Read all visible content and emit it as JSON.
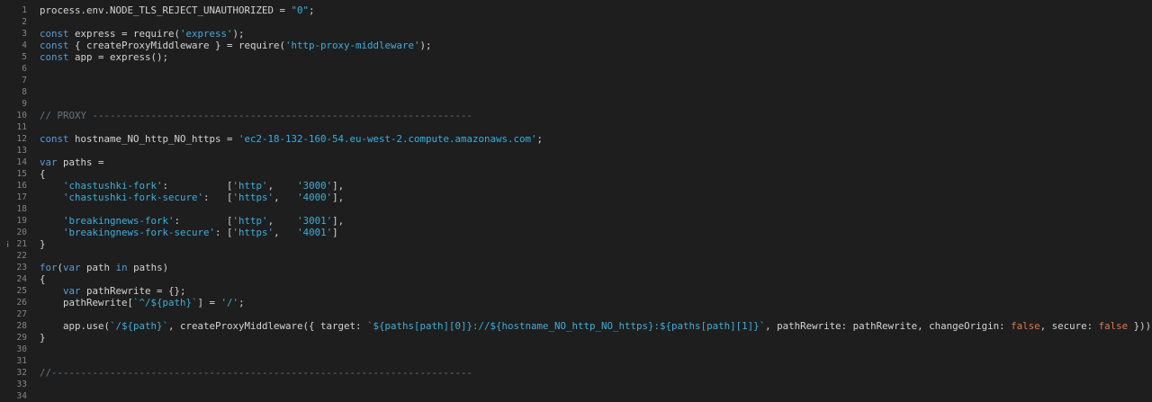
{
  "editor": {
    "gutter_glyph": "¡",
    "lines": [
      {
        "n": "1",
        "t": [
          [
            "plain",
            "process.env.NODE_TLS_REJECT_UNAUTHORIZED = "
          ],
          [
            "str",
            "\"0\""
          ],
          [
            "plain",
            ";"
          ]
        ]
      },
      {
        "n": "2",
        "t": []
      },
      {
        "n": "3",
        "t": [
          [
            "kw",
            "const"
          ],
          [
            "plain",
            " express = require("
          ],
          [
            "str",
            "'express'"
          ],
          [
            "plain",
            ");"
          ]
        ]
      },
      {
        "n": "4",
        "t": [
          [
            "kw",
            "const"
          ],
          [
            "plain",
            " { createProxyMiddleware } = require("
          ],
          [
            "str",
            "'http-proxy-middleware'"
          ],
          [
            "plain",
            ");"
          ]
        ]
      },
      {
        "n": "5",
        "t": [
          [
            "kw",
            "const"
          ],
          [
            "plain",
            " app = express();"
          ]
        ]
      },
      {
        "n": "6",
        "t": []
      },
      {
        "n": "7",
        "t": []
      },
      {
        "n": "8",
        "t": []
      },
      {
        "n": "9",
        "t": []
      },
      {
        "n": "10",
        "t": [
          [
            "cm",
            "// PROXY -----------------------------------------------------------------"
          ]
        ]
      },
      {
        "n": "11",
        "t": []
      },
      {
        "n": "12",
        "t": [
          [
            "kw",
            "const"
          ],
          [
            "plain",
            " hostname_NO_http_NO_https = "
          ],
          [
            "str",
            "'ec2-18-132-160-54.eu-west-2.compute.amazonaws.com'"
          ],
          [
            "plain",
            ";"
          ]
        ]
      },
      {
        "n": "13",
        "t": []
      },
      {
        "n": "14",
        "t": [
          [
            "kw",
            "var"
          ],
          [
            "plain",
            " paths ="
          ]
        ]
      },
      {
        "n": "15",
        "t": [
          [
            "plain",
            "{"
          ]
        ]
      },
      {
        "n": "16",
        "t": [
          [
            "plain",
            "    "
          ],
          [
            "str",
            "'chastushki-fork'"
          ],
          [
            "plain",
            ":          ["
          ],
          [
            "str",
            "'http'"
          ],
          [
            "plain",
            ",    "
          ],
          [
            "str",
            "'3000'"
          ],
          [
            "plain",
            "],"
          ]
        ]
      },
      {
        "n": "17",
        "t": [
          [
            "plain",
            "    "
          ],
          [
            "str",
            "'chastushki-fork-secure'"
          ],
          [
            "plain",
            ":   ["
          ],
          [
            "str",
            "'https'"
          ],
          [
            "plain",
            ",   "
          ],
          [
            "str",
            "'4000'"
          ],
          [
            "plain",
            "],"
          ]
        ]
      },
      {
        "n": "18",
        "t": []
      },
      {
        "n": "19",
        "t": [
          [
            "plain",
            "    "
          ],
          [
            "str",
            "'breakingnews-fork'"
          ],
          [
            "plain",
            ":        ["
          ],
          [
            "str",
            "'http'"
          ],
          [
            "plain",
            ",    "
          ],
          [
            "str",
            "'3001'"
          ],
          [
            "plain",
            "],"
          ]
        ]
      },
      {
        "n": "20",
        "t": [
          [
            "plain",
            "    "
          ],
          [
            "str",
            "'breakingnews-fork-secure'"
          ],
          [
            "plain",
            ": ["
          ],
          [
            "str",
            "'https'"
          ],
          [
            "plain",
            ",   "
          ],
          [
            "str",
            "'4001'"
          ],
          [
            "plain",
            "]"
          ]
        ]
      },
      {
        "n": "21",
        "glyph": true,
        "t": [
          [
            "plain",
            "}"
          ]
        ]
      },
      {
        "n": "22",
        "t": []
      },
      {
        "n": "23",
        "t": [
          [
            "kw",
            "for"
          ],
          [
            "plain",
            "("
          ],
          [
            "kw",
            "var"
          ],
          [
            "plain",
            " path "
          ],
          [
            "kw",
            "in"
          ],
          [
            "plain",
            " paths)"
          ]
        ]
      },
      {
        "n": "24",
        "t": [
          [
            "plain",
            "{"
          ]
        ]
      },
      {
        "n": "25",
        "t": [
          [
            "plain",
            "    "
          ],
          [
            "kw",
            "var"
          ],
          [
            "plain",
            " pathRewrite = {};"
          ]
        ]
      },
      {
        "n": "26",
        "t": [
          [
            "plain",
            "    pathRewrite["
          ],
          [
            "str",
            "`^/${path}`"
          ],
          [
            "plain",
            "] = "
          ],
          [
            "str",
            "'/'"
          ],
          [
            "plain",
            ";"
          ]
        ]
      },
      {
        "n": "27",
        "t": []
      },
      {
        "n": "28",
        "t": [
          [
            "plain",
            "    app.use("
          ],
          [
            "str",
            "`/${path}`"
          ],
          [
            "plain",
            ", createProxyMiddleware({ target: "
          ],
          [
            "str",
            "`${paths[path][0]}://${hostname_NO_http_NO_https}:${paths[path][1]}`"
          ],
          [
            "plain",
            ", pathRewrite: pathRewrite, changeOrigin: "
          ],
          [
            "bool",
            "false"
          ],
          [
            "plain",
            ", secure: "
          ],
          [
            "bool",
            "false"
          ],
          [
            "plain",
            " }));"
          ]
        ]
      },
      {
        "n": "29",
        "t": [
          [
            "plain",
            "}"
          ]
        ]
      },
      {
        "n": "30",
        "t": []
      },
      {
        "n": "31",
        "t": []
      },
      {
        "n": "32",
        "t": [
          [
            "cm",
            "//------------------------------------------------------------------------"
          ]
        ]
      },
      {
        "n": "33",
        "t": []
      },
      {
        "n": "34",
        "t": []
      }
    ]
  }
}
